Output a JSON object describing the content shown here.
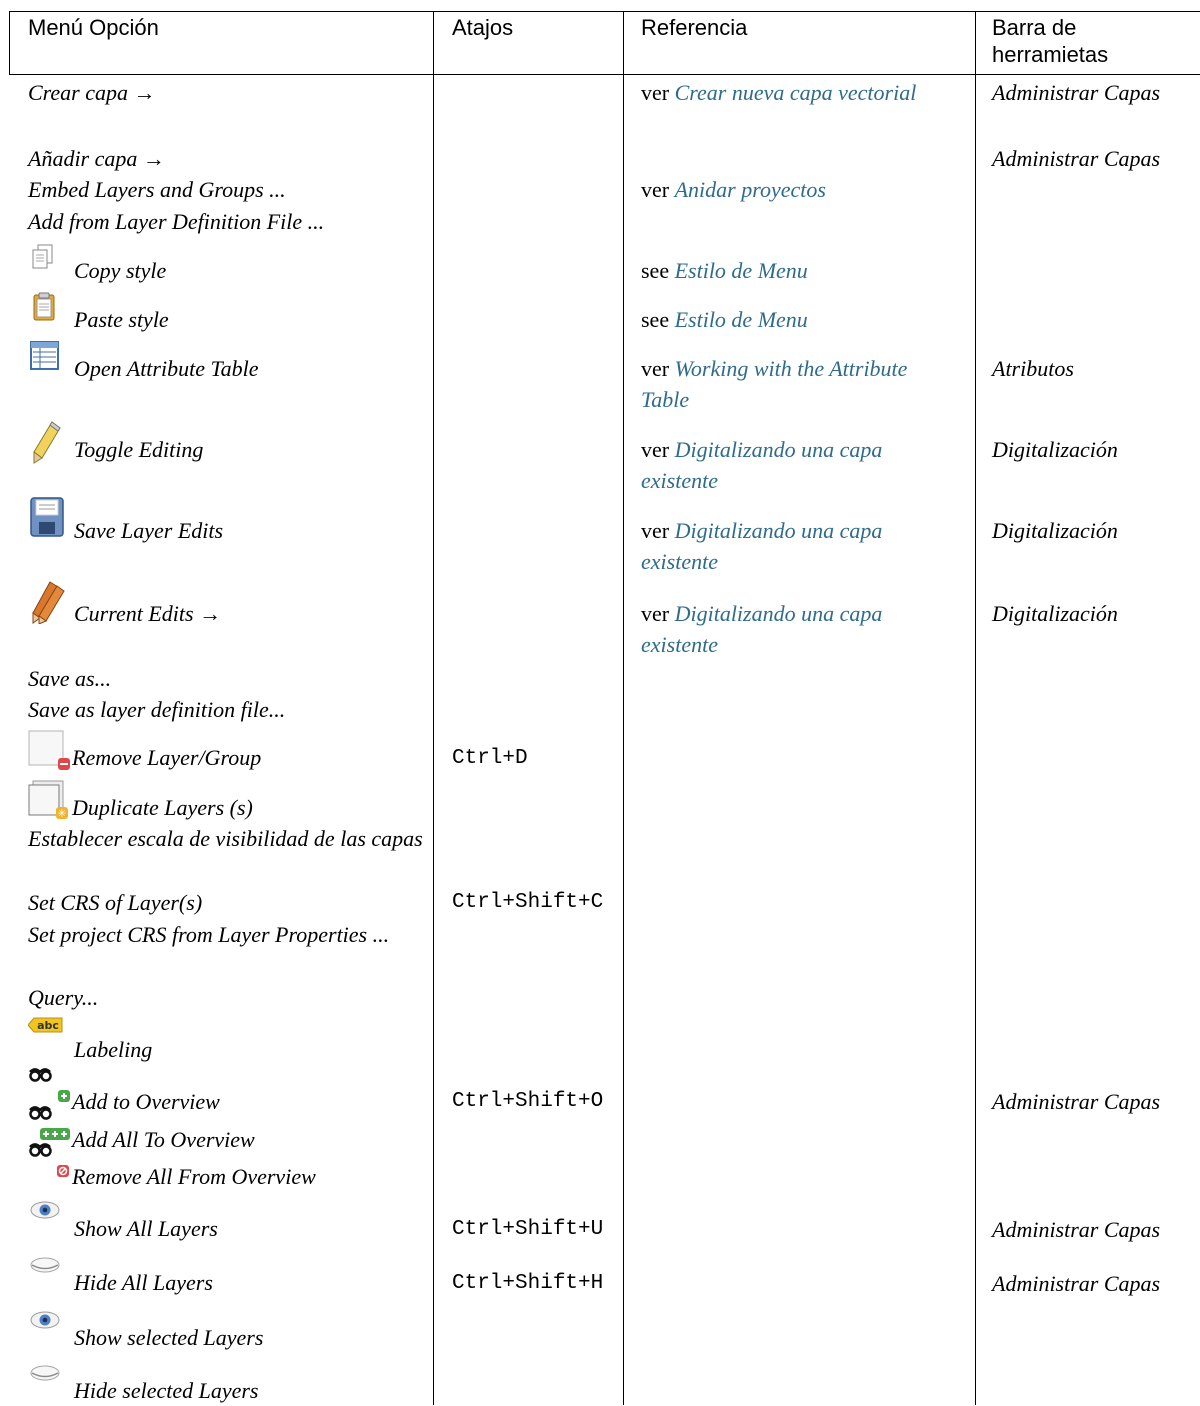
{
  "headers": {
    "menu": "Menú Opción",
    "shortcuts": "Atajos",
    "reference": "Referencia",
    "toolbar": "Barra de\nherramietas"
  },
  "rows": [
    {
      "menu": "Crear capa →",
      "shortcut": "",
      "ref_prefix": "ver ",
      "ref_link": "Crear nueva capa vectorial",
      "toolbar": "Administrar Capas",
      "icon": ""
    },
    {
      "menu": "Añadir capa →",
      "shortcut": "",
      "ref_prefix": "",
      "ref_link": "",
      "toolbar": "Administrar Capas",
      "icon": ""
    },
    {
      "menu": "Embed Layers and Groups ...",
      "shortcut": "",
      "ref_prefix": "ver ",
      "ref_link": "Anidar proyectos",
      "toolbar": "",
      "icon": ""
    },
    {
      "menu": "Add from Layer Definition File ...",
      "shortcut": "",
      "ref_prefix": "",
      "ref_link": "",
      "toolbar": "",
      "icon": ""
    },
    {
      "menu": "Copy style",
      "shortcut": "",
      "ref_prefix": "see ",
      "ref_link": "Estilo de Menu",
      "toolbar": "",
      "icon": "copy-style-icon"
    },
    {
      "menu": "Paste style",
      "shortcut": "",
      "ref_prefix": "see ",
      "ref_link": "Estilo de Menu",
      "toolbar": "",
      "icon": "paste-style-icon"
    },
    {
      "menu": "Open Attribute Table",
      "shortcut": "",
      "ref_prefix": "ver ",
      "ref_link": "Working with the Attribute Table",
      "toolbar": "Atributos",
      "icon": "attribute-table-icon"
    },
    {
      "menu": "Toggle Editing",
      "shortcut": "",
      "ref_prefix": "ver ",
      "ref_link": "Digitalizando una capa existente",
      "toolbar": "Digitalización",
      "icon": "pencil-icon"
    },
    {
      "menu": "Save Layer Edits",
      "shortcut": "",
      "ref_prefix": "ver ",
      "ref_link": "Digitalizando una capa existente",
      "toolbar": "Digitalización",
      "icon": "floppy-disk-icon"
    },
    {
      "menu": "Current Edits →",
      "shortcut": "",
      "ref_prefix": "ver ",
      "ref_link": "Digitalizando una capa existente",
      "toolbar": "Digitalización",
      "icon": "multi-pencil-icon"
    },
    {
      "menu": "Save as...",
      "shortcut": "",
      "ref_prefix": "",
      "ref_link": "",
      "toolbar": "",
      "icon": ""
    },
    {
      "menu": "Save as layer definition file...",
      "shortcut": "",
      "ref_prefix": "",
      "ref_link": "",
      "toolbar": "",
      "icon": ""
    },
    {
      "menu": "Remove Layer/Group",
      "shortcut": "Ctrl+D",
      "ref_prefix": "",
      "ref_link": "",
      "toolbar": "",
      "icon": "remove-layer-icon"
    },
    {
      "menu": "Duplicate Layers (s)",
      "shortcut": "",
      "ref_prefix": "",
      "ref_link": "",
      "toolbar": "",
      "icon": "duplicate-layer-icon"
    },
    {
      "menu": "Establecer escala de visibilidad de las capas",
      "shortcut": "",
      "ref_prefix": "",
      "ref_link": "",
      "toolbar": "",
      "icon": ""
    },
    {
      "menu": "Set CRS of Layer(s)",
      "shortcut": "Ctrl+Shift+C",
      "ref_prefix": "",
      "ref_link": "",
      "toolbar": "",
      "icon": ""
    },
    {
      "menu": "Set project CRS from Layer Properties ...",
      "shortcut": "",
      "ref_prefix": "",
      "ref_link": "",
      "toolbar": "",
      "icon": ""
    },
    {
      "menu": "Query...",
      "shortcut": "",
      "ref_prefix": "",
      "ref_link": "",
      "toolbar": "",
      "icon": ""
    },
    {
      "menu": "Labeling",
      "shortcut": "",
      "ref_prefix": "",
      "ref_link": "",
      "toolbar": "",
      "icon": "labeling-abc-icon"
    },
    {
      "menu": "Add to Overview",
      "shortcut": "Ctrl+Shift+O",
      "ref_prefix": "",
      "ref_link": "",
      "toolbar": "Administrar Capas",
      "icon": "add-overview-icon"
    },
    {
      "menu": "Add All To Overview",
      "shortcut": "",
      "ref_prefix": "",
      "ref_link": "",
      "toolbar": "",
      "icon": "add-all-overview-icon"
    },
    {
      "menu": "Remove All From Overview",
      "shortcut": "",
      "ref_prefix": "",
      "ref_link": "",
      "toolbar": "",
      "icon": "remove-all-overview-icon"
    },
    {
      "menu": "Show All Layers",
      "shortcut": "Ctrl+Shift+U",
      "ref_prefix": "",
      "ref_link": "",
      "toolbar": "Administrar Capas",
      "icon": "eye-open-icon"
    },
    {
      "menu": "Hide All Layers",
      "shortcut": "Ctrl+Shift+H",
      "ref_prefix": "",
      "ref_link": "",
      "toolbar": "Administrar Capas",
      "icon": "eye-closed-icon"
    },
    {
      "menu": "Show selected Layers",
      "shortcut": "",
      "ref_prefix": "",
      "ref_link": "",
      "toolbar": "",
      "icon": "eye-open-icon"
    },
    {
      "menu": "Hide selected Layers",
      "shortcut": "",
      "ref_prefix": "",
      "ref_link": "",
      "toolbar": "",
      "icon": "eye-closed-icon"
    }
  ]
}
